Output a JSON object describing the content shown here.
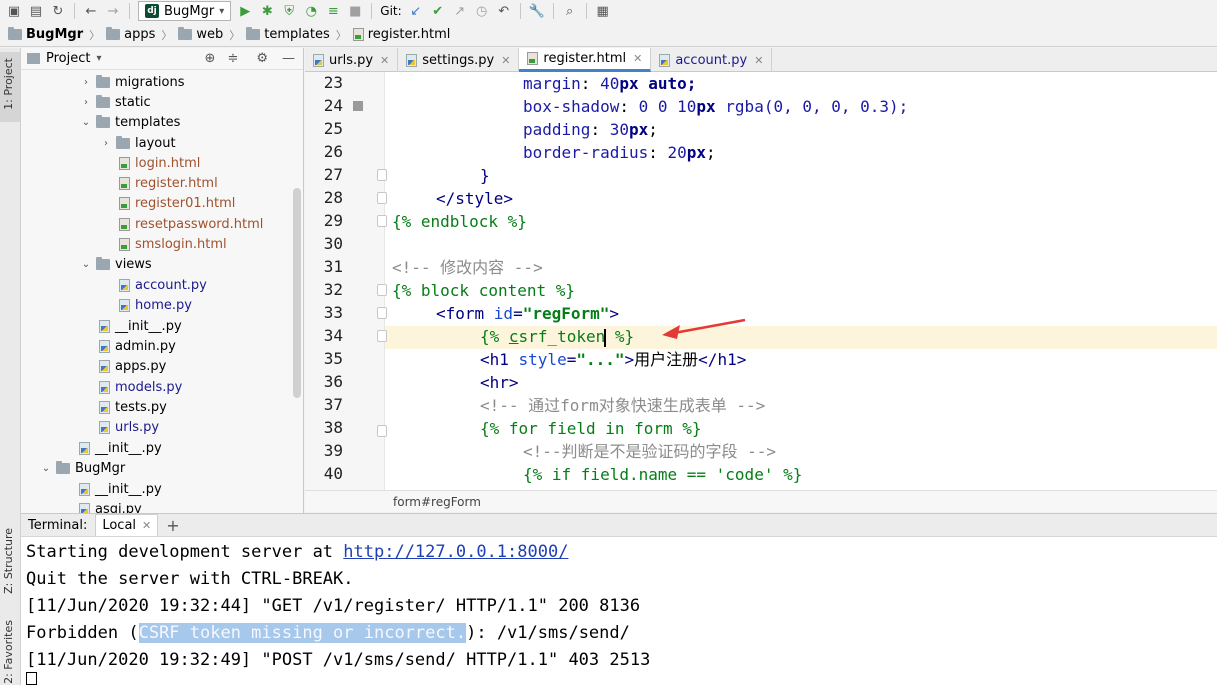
{
  "toolbar": {
    "run_config": "BugMgr",
    "git_label": "Git:",
    "icons": [
      "save-icon",
      "save-all-icon",
      "sync-icon",
      "back-icon",
      "forward-icon",
      "run-icon",
      "debug-icon",
      "coverage-icon",
      "profile-icon",
      "build-icon",
      "stop-icon",
      "git-update-icon",
      "git-commit-icon",
      "git-push-icon",
      "history-icon",
      "rollback-icon",
      "settings-icon",
      "search-icon",
      "structure-icon"
    ]
  },
  "breadcrumb": {
    "items": [
      "BugMgr",
      "apps",
      "web",
      "templates",
      "register.html"
    ]
  },
  "left_stripe": {
    "project_tab": "1: Project",
    "structure_tab": "Z: Structure",
    "favorites_tab": "2: Favorites"
  },
  "project_panel": {
    "title": "Project",
    "tree": [
      {
        "label": "migrations",
        "kind": "folder",
        "chevron": "›"
      },
      {
        "label": "static",
        "kind": "folder",
        "chevron": "›"
      },
      {
        "label": "templates",
        "kind": "folder",
        "chevron": "⌄"
      },
      {
        "label": "layout",
        "kind": "folder",
        "chevron": "›"
      },
      {
        "label": "login.html",
        "kind": "html"
      },
      {
        "label": "register.html",
        "kind": "html"
      },
      {
        "label": "register01.html",
        "kind": "html"
      },
      {
        "label": "resetpassword.html",
        "kind": "html"
      },
      {
        "label": "smslogin.html",
        "kind": "html"
      },
      {
        "label": "views",
        "kind": "folder",
        "chevron": "⌄"
      },
      {
        "label": "account.py",
        "kind": "py-blue"
      },
      {
        "label": "home.py",
        "kind": "py-blue"
      },
      {
        "label": "__init__.py",
        "kind": "py"
      },
      {
        "label": "admin.py",
        "kind": "py"
      },
      {
        "label": "apps.py",
        "kind": "py"
      },
      {
        "label": "models.py",
        "kind": "py-blue"
      },
      {
        "label": "tests.py",
        "kind": "py"
      },
      {
        "label": "urls.py",
        "kind": "py-blue"
      },
      {
        "label": "__init__.py",
        "kind": "py"
      },
      {
        "label": "BugMgr",
        "kind": "folder",
        "chevron": "⌄"
      },
      {
        "label": "__init__.py",
        "kind": "py"
      },
      {
        "label": "asgi.py",
        "kind": "py"
      }
    ]
  },
  "editor_tabs": [
    {
      "label": "urls.py",
      "kind": "py"
    },
    {
      "label": "settings.py",
      "kind": "py"
    },
    {
      "label": "register.html",
      "kind": "html",
      "active": true
    },
    {
      "label": "account.py",
      "kind": "py"
    }
  ],
  "editor": {
    "line_numbers": [
      "23",
      "24",
      "25",
      "26",
      "27",
      "28",
      "29",
      "30",
      "31",
      "32",
      "33",
      "34",
      "35",
      "36",
      "37",
      "38",
      "39",
      "40"
    ],
    "current_line": "34",
    "crumb": "form#regForm",
    "lines": {
      "l23": {
        "prop": "margin",
        "colon": ": ",
        "num": "40",
        "unit": "px",
        "rest": " auto;"
      },
      "l24": {
        "prop": "box-shadow",
        "colon": ": ",
        "a": "0 0 ",
        "num": "10",
        "unit": "px",
        "rest": " rgba(0, 0, 0, 0.3);"
      },
      "l25": {
        "prop": "padding",
        "colon": ": ",
        "num": "30",
        "unit": "px",
        "rest": ";"
      },
      "l26": {
        "prop": "border-radius",
        "colon": ": ",
        "num": "20",
        "unit": "px",
        "rest": ";"
      },
      "l27": "}",
      "l28": "</style>",
      "l29": "{% endblock %}",
      "l31": "<!-- 修改内容 -->",
      "l32": "{% block content %}",
      "l33": {
        "open": "<form ",
        "attr": "id",
        "eq": "=",
        "val": "\"regForm\"",
        "close": ">"
      },
      "l34": {
        "a": "{% ",
        "sel": "c",
        "b": "srf_token",
        "cursor": "|",
        "c": " %}"
      },
      "l35": {
        "open": "<h1 ",
        "attr": "style",
        "eq": "=",
        "val": "\"...\"",
        "gt": ">",
        "text": "用户注册",
        "close": "</h1>"
      },
      "l36": "<hr>",
      "l37": "<!-- 通过form对象快速生成表单 -->",
      "l38": "{% for field in form %}",
      "l39": "<!--判断是不是验证码的字段 -->",
      "l40": "{% if field.name == 'code' %}"
    }
  },
  "terminal": {
    "tab_label": "Terminal:",
    "local_tab": "Local",
    "add_label": "+",
    "line1_a": "Starting development server at ",
    "line1_link": "http://127.0.0.1:8000/",
    "line2": "Quit the server with CTRL-BREAK.",
    "line3": "[11/Jun/2020 19:32:44] \"GET /v1/register/ HTTP/1.1\" 200 8136",
    "line4_a": "Forbidden (",
    "line4_sel": "CSRF token missing or incorrect.",
    "line4_b": "): /v1/sms/send/",
    "line5": "[11/Jun/2020 19:32:49] \"POST /v1/sms/send/ HTTP/1.1\" 403 2513"
  },
  "colors": {
    "accent": "#4083c9",
    "current_line": "#fcf5dc",
    "selection": "#a6c8ea",
    "arrow": "#e53935"
  }
}
